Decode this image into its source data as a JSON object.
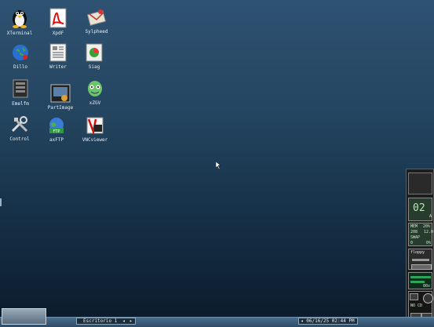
{
  "desktop": {
    "icons": [
      {
        "label": "XTerminal",
        "icon": "tux-terminal-icon"
      },
      {
        "label": "XpdF",
        "icon": "pdf-icon"
      },
      {
        "label": "Sylpheed",
        "icon": "mail-icon"
      },
      {
        "label": "Dillo",
        "icon": "web-browser-icon"
      },
      {
        "label": "Writer",
        "icon": "document-icon"
      },
      {
        "label": "Siag",
        "icon": "spreadsheet-icon"
      },
      {
        "label": "Emelfm",
        "icon": "file-manager-icon"
      },
      {
        "label": "PartImage",
        "icon": "partition-icon"
      },
      {
        "label": "xZGV",
        "icon": "image-viewer-icon"
      },
      {
        "label": "Control",
        "icon": "tools-icon"
      },
      {
        "label": "axFTP",
        "icon": "ftp-icon"
      },
      {
        "label": "VNCviewer",
        "icon": "vnc-icon"
      }
    ]
  },
  "taskbar": {
    "desktop_name": "Escritorio 1",
    "prev_arrow": "◂",
    "next_arrow": "▸",
    "clock": "06/16/25 02:44 PM",
    "clock_arrow": "◂"
  },
  "dock": {
    "clock_value": "02",
    "clock_small": "A",
    "mem_label": "MEM",
    "mem_value": "20%",
    "mem_used": "208",
    "mem_total": "12.0",
    "swap_label": "SWAP",
    "swap_used": "0",
    "swap_free": "0%",
    "floppy_label": "floppy",
    "disk_label": "80x",
    "cd_label": "NO CD"
  }
}
